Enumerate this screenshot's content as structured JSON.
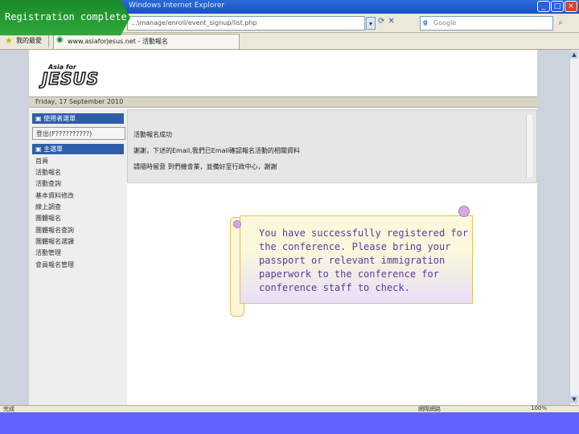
{
  "overlay": {
    "label": "Registration complete"
  },
  "browser": {
    "window_title": "Windows Internet Explorer",
    "address": "...\\manage/enroll/event_signup/list.php",
    "search_placeholder": "Google",
    "favorites_label": "我的最愛",
    "tab_label": "www.asiaforjesus.net - 活動報名",
    "status_left": "完成",
    "status_zone": "網際網路",
    "status_zoom": "100%"
  },
  "site": {
    "logo_small": "Asia for",
    "logo_big": "JESUS",
    "date": "Friday, 17 September 2010",
    "sidebar": {
      "user_menu_title": "使用者選單",
      "login_text": "登出(F??????????)",
      "main_menu_title": "主選單",
      "items": [
        "首頁",
        "活動報名",
        "活動查詢",
        "基本資料修改",
        "線上調查",
        "團體報名",
        "團體報名查詢",
        "團體報名選課",
        "活動管理",
        "會員報名管理"
      ]
    },
    "content": {
      "line1": "活動報名成功",
      "line2": "謝謝，下述的Email,我們已Email確認報名活動的相關資料",
      "line3": "請隨時留意 到們機會業，並備好至行政中心，謝謝"
    }
  },
  "callout": {
    "text": "You have successfully registered for the conference. Please bring your passport or relevant immigration paperwork to the conference for conference staff to check."
  },
  "colors": {
    "accent": "#2e5ea8",
    "overlay_green": "#1f9a2f",
    "bottom_band": "#6262ff"
  }
}
